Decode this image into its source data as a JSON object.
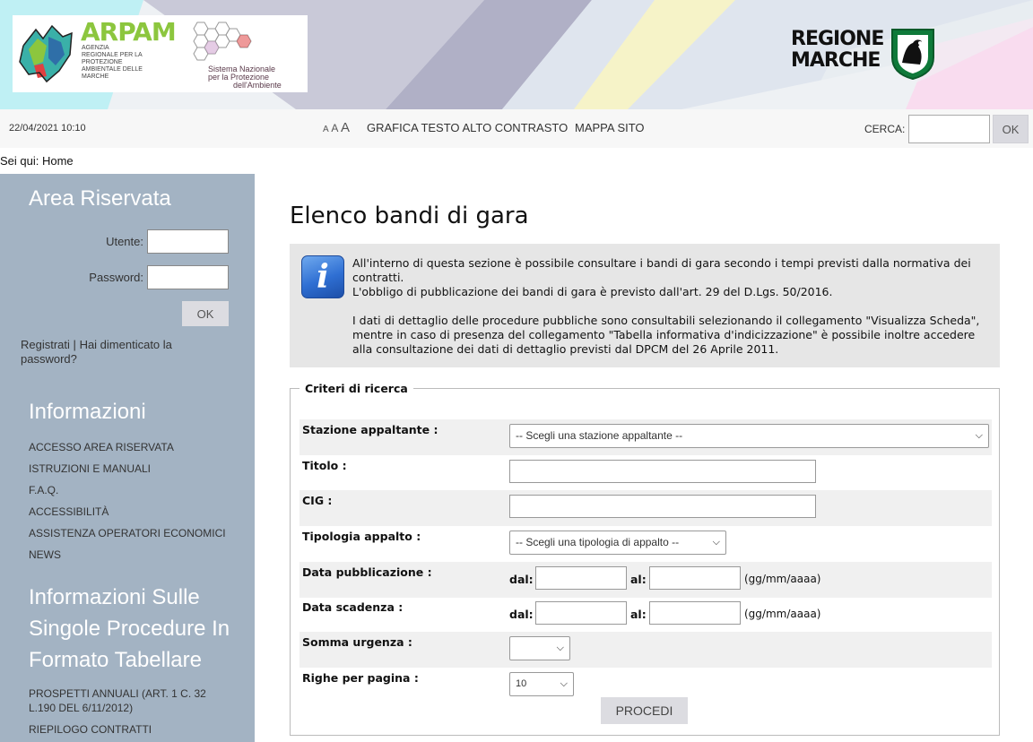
{
  "header": {
    "arpam_title": "ARPAM",
    "arpam_subtitle": "AGENZIA REGIONALE PER LA PROTEZIONE AMBIENTALE DELLE MARCHE",
    "snpa_line1": "Sistema Nazionale",
    "snpa_line2": "per la Protezione",
    "snpa_line3": "dell'Ambiente",
    "regione_line1": "REGIONE",
    "regione_line2": "MARCHE"
  },
  "toolbar": {
    "datetime": "22/04/2021 10:10",
    "font_small": "A",
    "font_medium": "A",
    "font_large": "A",
    "link_contrast": "GRAFICA TESTO ALTO CONTRASTO",
    "link_map": "MAPPA SITO",
    "search_label": "CERCA:",
    "search_value": "",
    "search_button": "OK"
  },
  "breadcrumb": "Sei qui: Home",
  "sidebar": {
    "login_title": "Area Riservata",
    "user_label": "Utente:",
    "password_label": "Password:",
    "ok_button": "OK",
    "register_link": "Registrati",
    "separator": "|",
    "forgot_link": "Hai dimenticato la password?",
    "info_title": "Informazioni",
    "info_items": [
      "ACCESSO AREA RISERVATA",
      "ISTRUZIONI E MANUALI",
      "F.A.Q.",
      "ACCESSIBILITÀ",
      "ASSISTENZA OPERATORI ECONOMICI",
      "NEWS"
    ],
    "proc_title": "Informazioni Sulle Singole Procedure In Formato Tabellare",
    "proc_items": [
      "PROSPETTI ANNUALI (ART. 1 C. 32 L.190 DEL 6/11/2012)",
      "RIEPILOGO CONTRATTI"
    ]
  },
  "main": {
    "title": "Elenco bandi di gara",
    "info_icon": "info-icon",
    "info_p1": "All'interno di questa sezione è possibile consultare i bandi di gara secondo i tempi previsti dalla normativa dei contratti.",
    "info_p2": "L'obbligo di pubblicazione dei bandi di gara è previsto dall'art. 29 del D.Lgs. 50/2016.",
    "info_p3": "I dati di dettaglio delle procedure pubbliche sono consultabili selezionando il collegamento \"Visualizza Scheda\", mentre in caso di presenza del collegamento \"Tabella informativa d'indicizzazione\" è possibile inoltre accedere alla consultazione dei dati di dettaglio previsti dal DPCM del 26 Aprile 2011."
  },
  "form": {
    "legend": "Criteri di ricerca",
    "stazione_label": "Stazione appaltante :",
    "stazione_value": "-- Scegli una stazione appaltante --",
    "titolo_label": "Titolo :",
    "titolo_value": "",
    "cig_label": "CIG :",
    "cig_value": "",
    "tipologia_label": "Tipologia appalto :",
    "tipologia_value": "-- Scegli una tipologia di appalto --",
    "data_pub_label": "Data pubblicazione :",
    "data_scad_label": "Data scadenza :",
    "dal": "dal:",
    "al": "al:",
    "date_hint": "(gg/mm/aaaa)",
    "urgenza_label": "Somma urgenza :",
    "urgenza_value": "",
    "righe_label": "Righe per pagina :",
    "righe_value": "10",
    "procedi_button": "PROCEDI"
  }
}
